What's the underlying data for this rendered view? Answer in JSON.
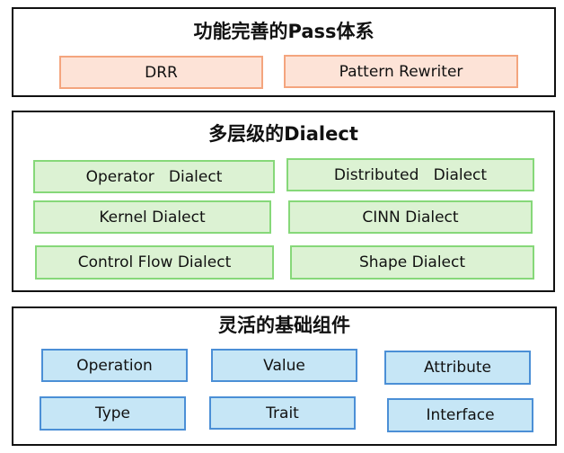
{
  "colors": {
    "orange_fill": "#fde3d7",
    "orange_border": "#f4a57e",
    "green_fill": "#dcf2d3",
    "green_border": "#86d879",
    "blue_fill": "#c6e6f6",
    "blue_border": "#4b8fd6",
    "panel_border": "#111111"
  },
  "panels": [
    {
      "title": "功能完善的Pass体系",
      "items": [
        "DRR",
        "Pattern Rewriter"
      ]
    },
    {
      "title": "多层级的Dialect",
      "items": [
        "Operator   Dialect",
        "Distributed   Dialect",
        "Kernel Dialect",
        "CINN Dialect",
        "Control Flow Dialect",
        "Shape Dialect"
      ]
    },
    {
      "title": "灵活的基础组件",
      "items": [
        "Operation",
        "Value",
        "Attribute",
        "Type",
        "Trait",
        "Interface"
      ]
    }
  ]
}
